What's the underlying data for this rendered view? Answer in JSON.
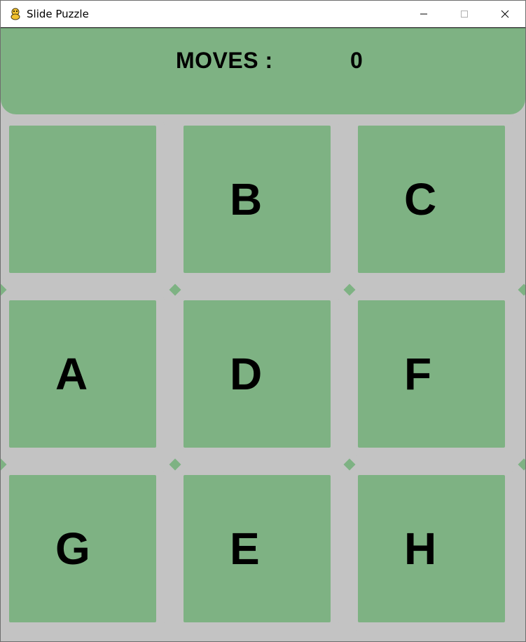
{
  "window": {
    "title": "Slide Puzzle",
    "controls": [
      "minimize-icon",
      "maximize-icon",
      "close-icon"
    ]
  },
  "header": {
    "moves_label": "MOVES :",
    "moves_value": "0"
  },
  "board": {
    "tiles": [
      "",
      "B",
      "C",
      "A",
      "D",
      "F",
      "G",
      "E",
      "H"
    ],
    "empty_index": 0
  },
  "colors": {
    "tile": "#7eb283",
    "board_background": "#c3c3c3",
    "text": "#000000"
  }
}
